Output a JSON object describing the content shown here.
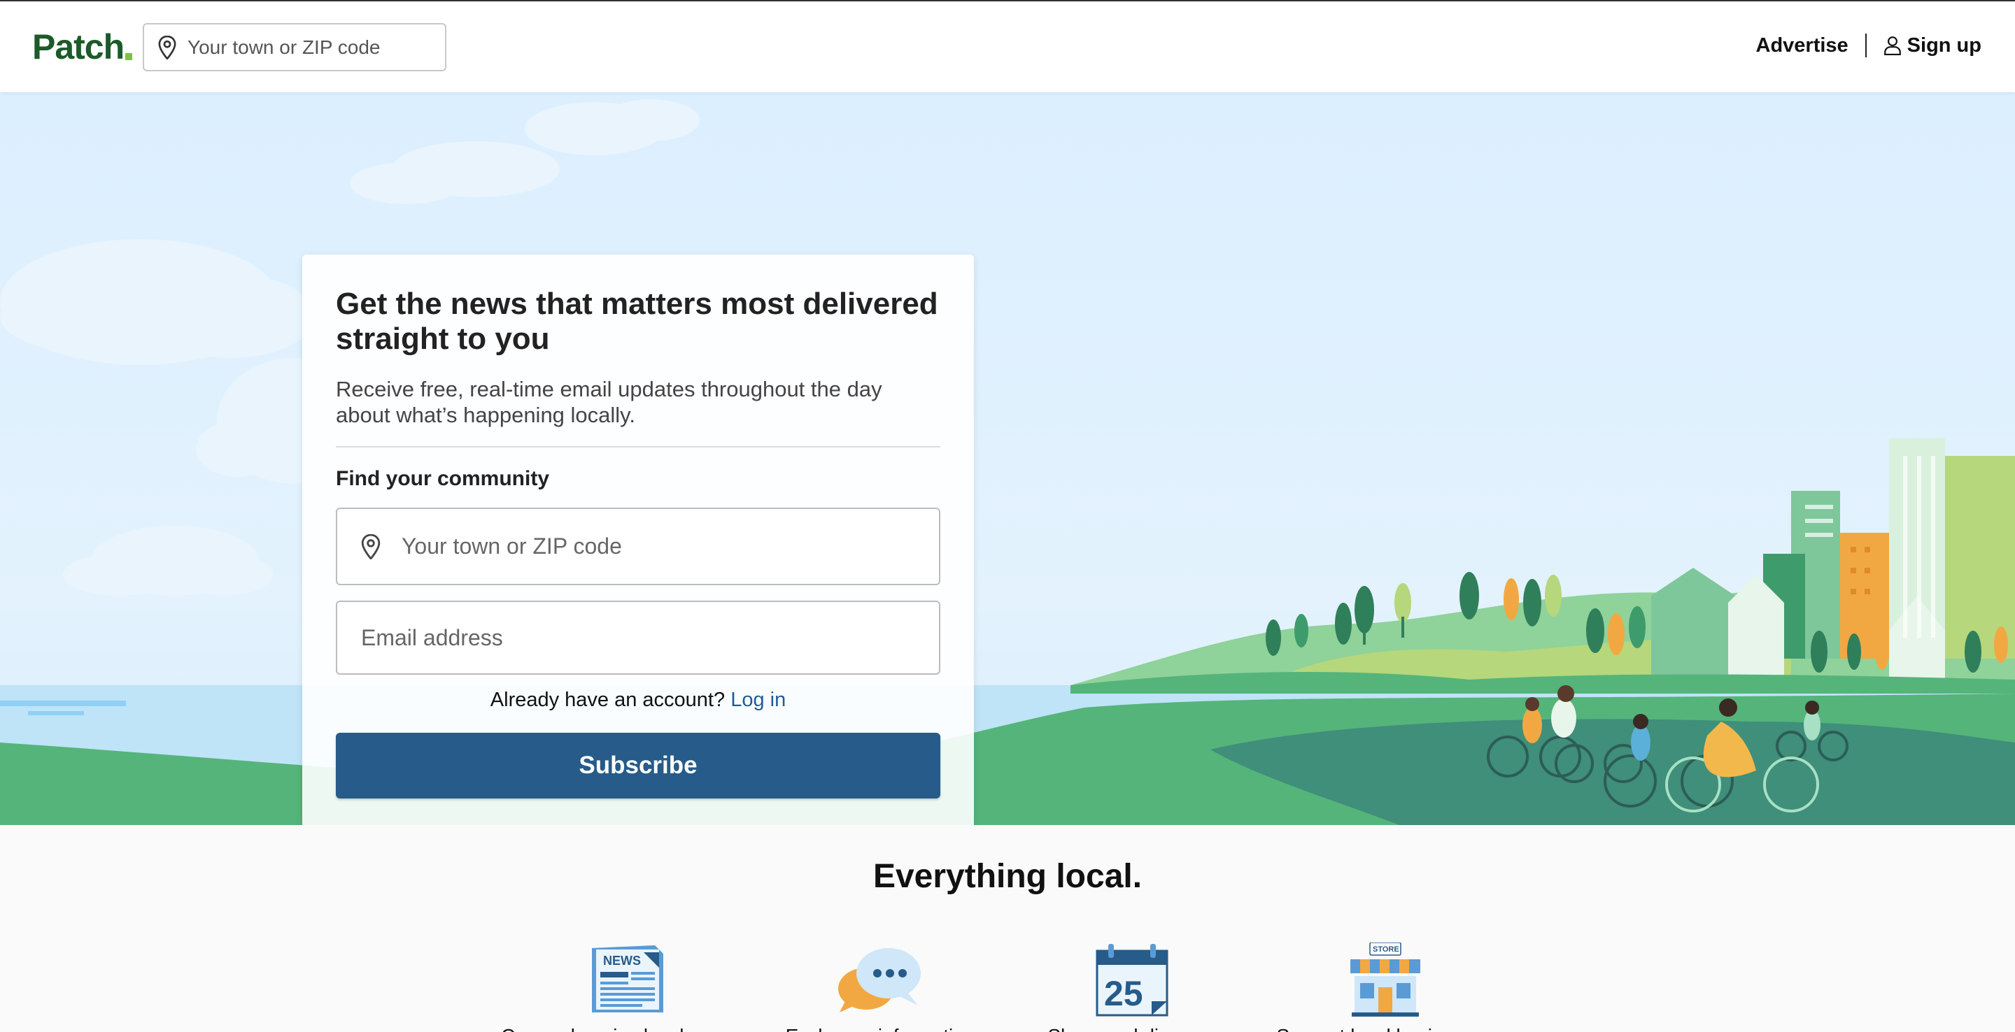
{
  "header": {
    "logo": "Patch",
    "search_placeholder": "Your town or ZIP code",
    "advertise": "Advertise",
    "signup": "Sign up"
  },
  "hero": {
    "title": "Get the news that matters most delivered straight to you",
    "subtitle": "Receive free, real-time email updates throughout the day about what’s happening locally.",
    "find_label": "Find your community",
    "town_placeholder": "Your town or ZIP code",
    "email_placeholder": "Email address",
    "account_text": "Already have an account?",
    "login_link": "Log in",
    "subscribe": "Subscribe"
  },
  "everything": {
    "title": "Everything local.",
    "features": [
      {
        "icon": "newspaper-icon",
        "badge": "NEWS",
        "text": "Comprehensive local coverage"
      },
      {
        "icon": "chat-bubbles-icon",
        "text": "Exchange information"
      },
      {
        "icon": "calendar-icon",
        "badge": "25",
        "text": "Share and discover"
      },
      {
        "icon": "store-icon",
        "badge": "STORE",
        "text": "Support local businesses"
      }
    ]
  },
  "colors": {
    "brand_green": "#1c5a2a",
    "subscribe_blue": "#265b8a",
    "link_blue": "#1f5c99",
    "grass": "#55b47a"
  }
}
